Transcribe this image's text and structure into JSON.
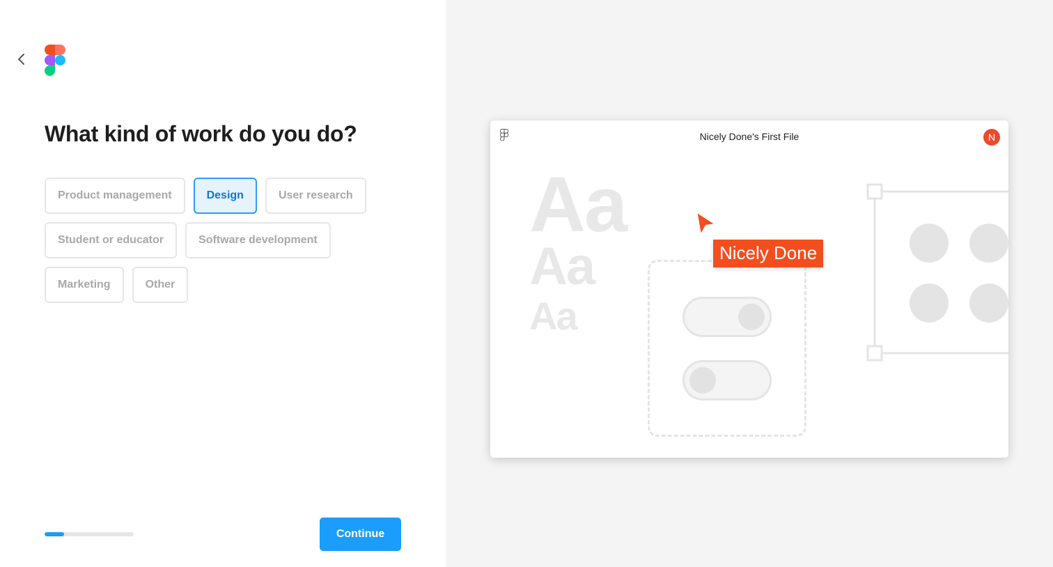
{
  "header": {
    "back_icon": "chevron-left-icon",
    "logo": "figma-logo"
  },
  "question": "What kind of work do you do?",
  "options": [
    {
      "label": "Product management",
      "selected": false
    },
    {
      "label": "Design",
      "selected": true
    },
    {
      "label": "User research",
      "selected": false
    },
    {
      "label": "Student or educator",
      "selected": false
    },
    {
      "label": "Software development",
      "selected": false
    },
    {
      "label": "Marketing",
      "selected": false
    },
    {
      "label": "Other",
      "selected": false
    }
  ],
  "progress": {
    "fraction": 0.22
  },
  "continue_label": "Continue",
  "preview": {
    "file_title": "Nicely Done's First File",
    "avatar_initial": "N",
    "type_samples": [
      "Aa",
      "Aa",
      "Aa"
    ],
    "collaborator_tag": "Nicely Done"
  },
  "colors": {
    "accent": "#1a9dfb",
    "selected_border": "#2f9bf0",
    "selected_bg": "#e6f2fc",
    "collaborator": "#f24e1e"
  }
}
